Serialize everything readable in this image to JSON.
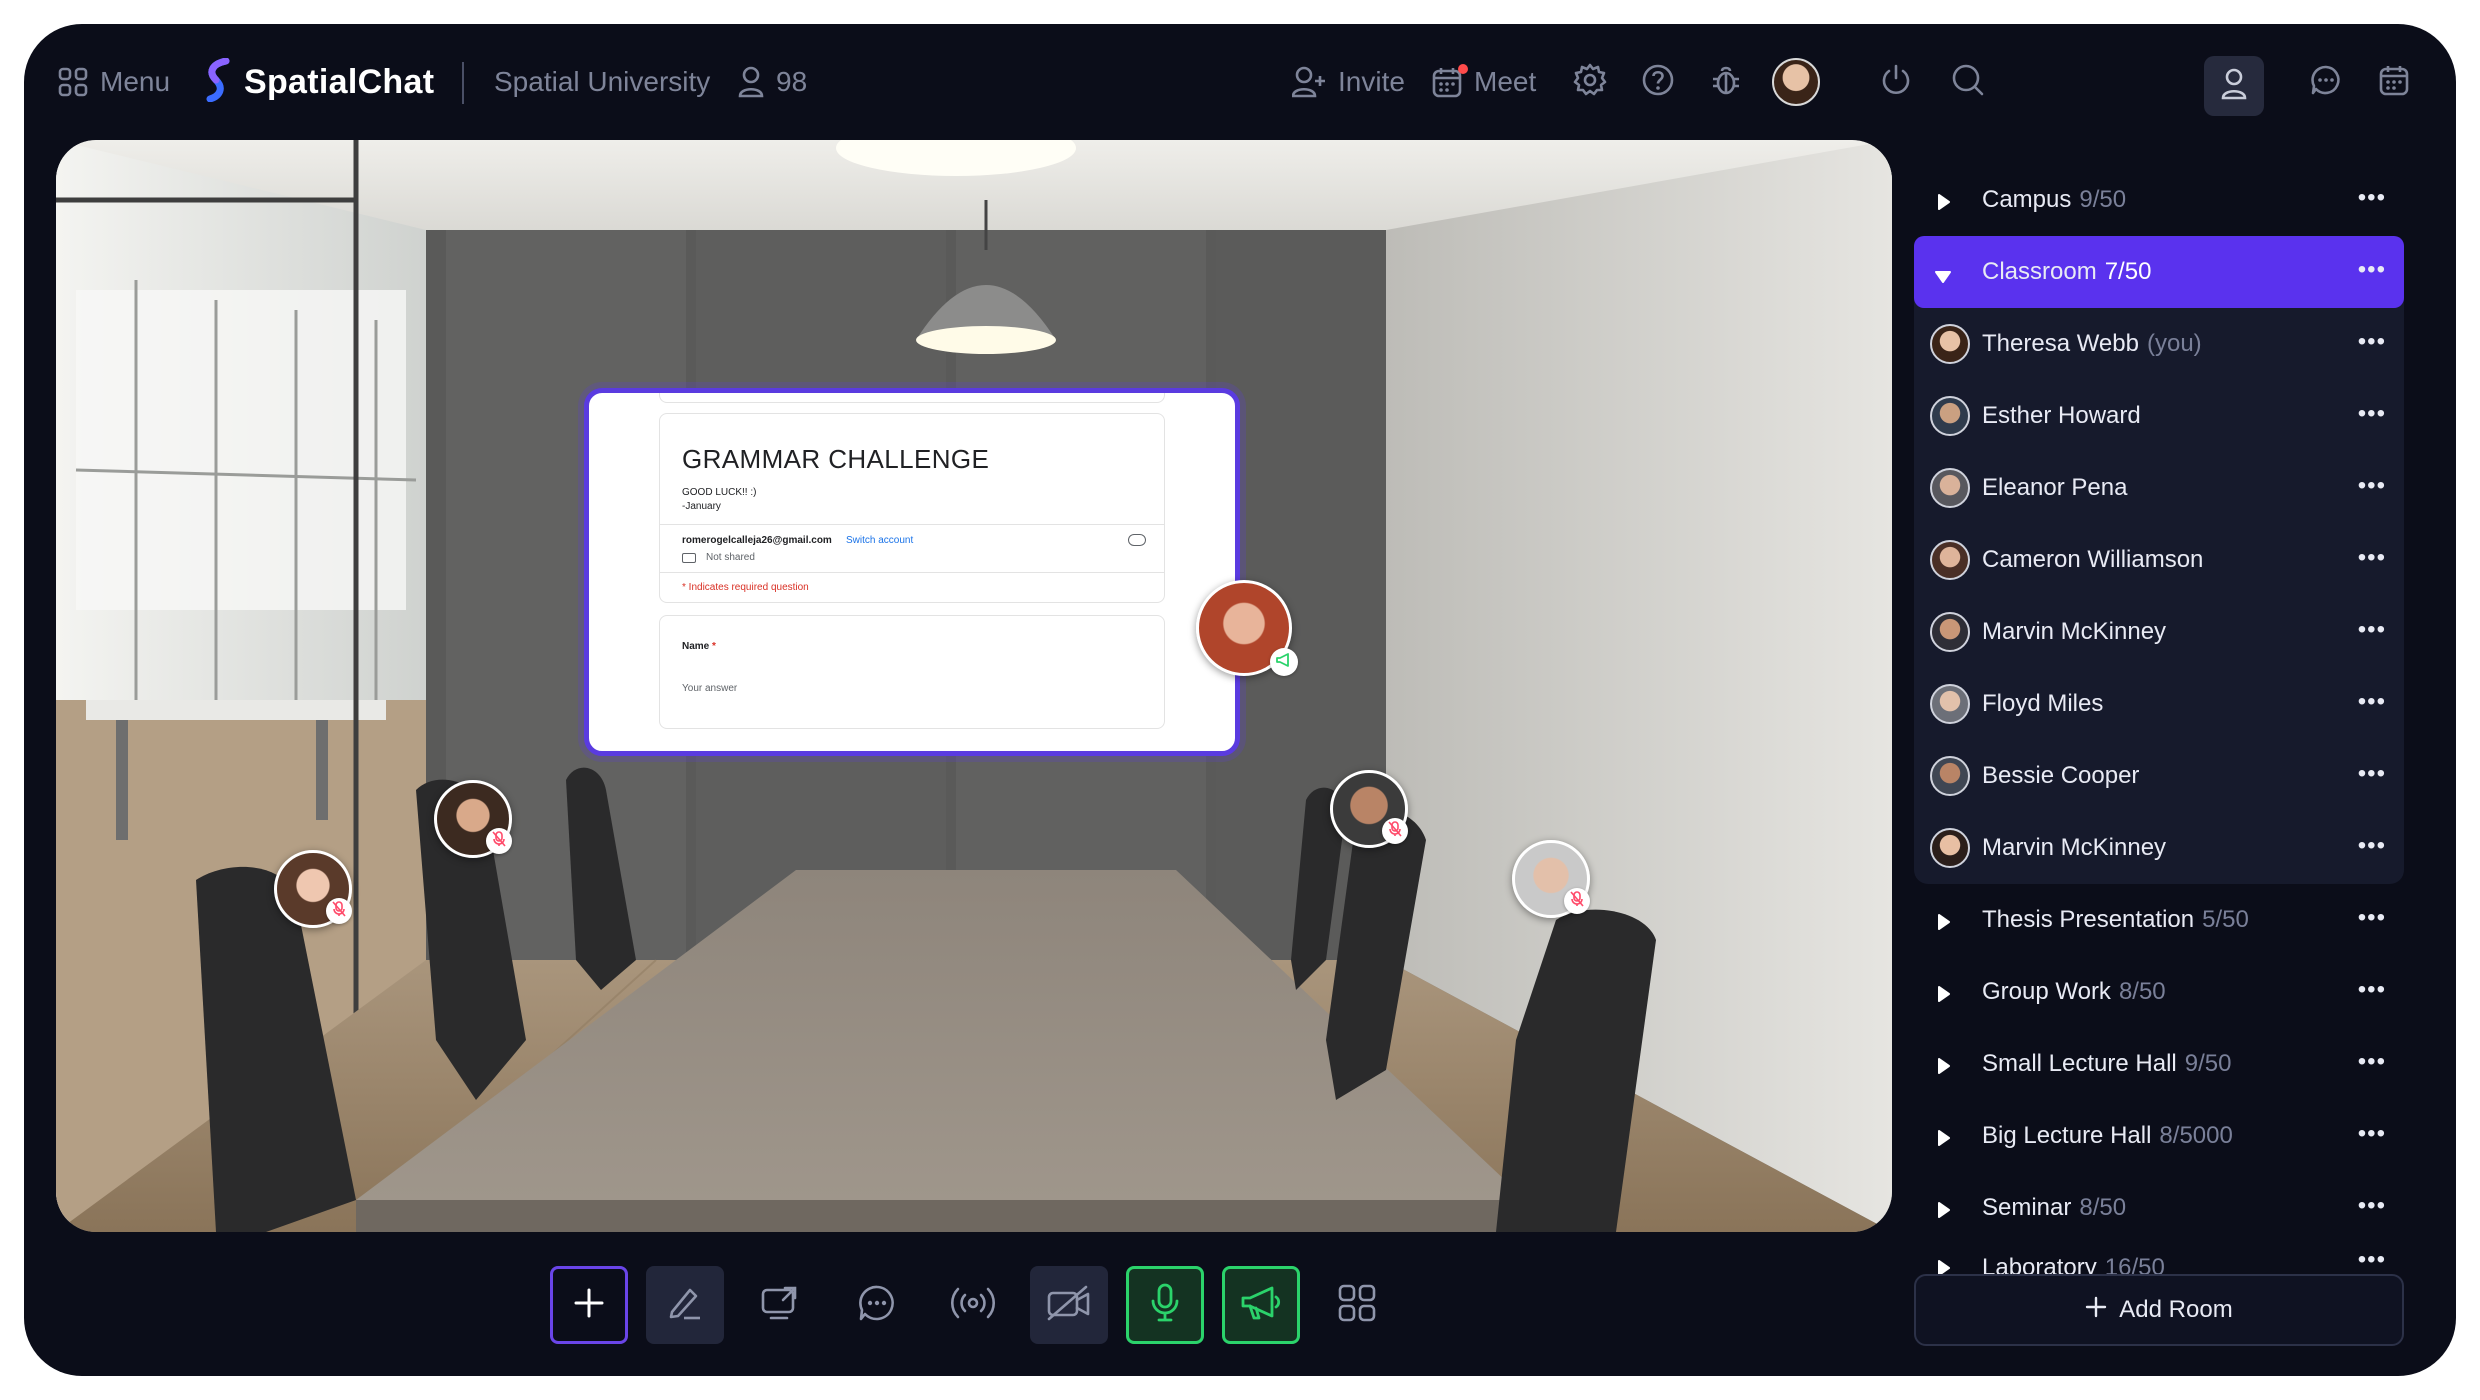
{
  "topbar": {
    "menu_label": "Menu",
    "brand": "SpatialChat",
    "space_name": "Spatial University",
    "participant_count": "98",
    "invite_label": "Invite",
    "meet_label": "Meet"
  },
  "screen_share": {
    "title": "GRAMMAR CHALLENGE",
    "description_line1": "GOOD LUCK!! :)",
    "description_line2": "-January",
    "account_email": "romerogelcalleja26@gmail.com",
    "switch_account": "Switch account",
    "not_shared": "Not shared",
    "required_note": "* Indicates required question",
    "question_label": "Name",
    "question_required_mark": "*",
    "answer_placeholder": "Your answer"
  },
  "rooms_before": [
    {
      "name": "Campus",
      "count": "9/50"
    }
  ],
  "active_room": {
    "name": "Classroom",
    "count": "7/50"
  },
  "members": [
    {
      "name": "Theresa Webb",
      "suffix": "(you)"
    },
    {
      "name": "Esther Howard",
      "suffix": ""
    },
    {
      "name": "Eleanor Pena",
      "suffix": ""
    },
    {
      "name": "Cameron Williamson",
      "suffix": ""
    },
    {
      "name": "Marvin McKinney",
      "suffix": ""
    },
    {
      "name": "Floyd Miles",
      "suffix": ""
    },
    {
      "name": "Bessie Cooper",
      "suffix": ""
    },
    {
      "name": "Marvin McKinney",
      "suffix": ""
    }
  ],
  "rooms_after": [
    {
      "name": "Thesis Presentation",
      "count": "5/50"
    },
    {
      "name": "Group Work",
      "count": "8/50"
    },
    {
      "name": "Small Lecture Hall",
      "count": "9/50"
    },
    {
      "name": "Big Lecture Hall",
      "count": "8/5000"
    },
    {
      "name": "Seminar",
      "count": "8/50"
    },
    {
      "name": "Laboratory",
      "count": "16/50"
    }
  ],
  "more_glyph": "•••",
  "add_room_label": "Add Room",
  "colors": {
    "background": "#0b0d19",
    "accent": "#5a32ee",
    "active_green": "#2bd36b",
    "muted_red": "#ff4b6a"
  },
  "icons": [
    "grid-icon",
    "spatialchat-logo",
    "person-icon",
    "add-user-icon",
    "calendar-icon",
    "gear-icon",
    "help-icon",
    "bug-icon",
    "power-icon",
    "search-icon",
    "chat-icon",
    "plus-icon",
    "pen-icon",
    "share-screen-icon",
    "broadcast-icon",
    "camera-off-icon",
    "microphone-icon",
    "megaphone-icon",
    "apps-icon"
  ]
}
